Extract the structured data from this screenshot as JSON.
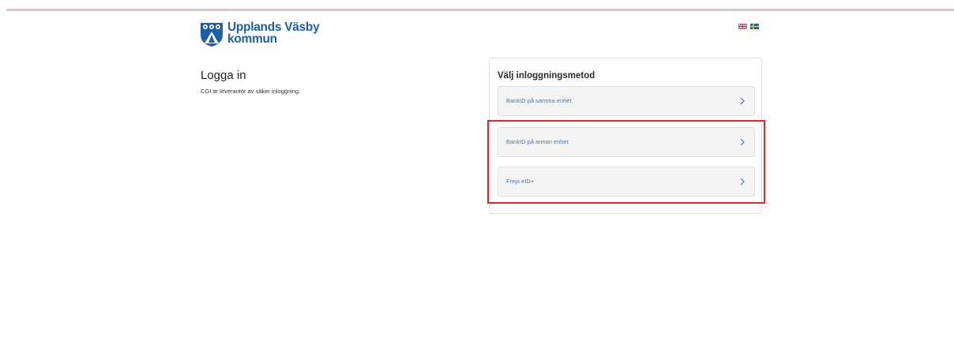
{
  "brand": {
    "name_line1": "Upplands Väsby",
    "name_line2": "kommun",
    "color": "#1d5fa7"
  },
  "languages": [
    {
      "icon": "uk-flag-icon"
    },
    {
      "icon": "sweden-flag-icon"
    }
  ],
  "page": {
    "title": "Logga in",
    "subtitle": "CGI är leverantör av säker inloggning."
  },
  "login_card": {
    "title": "Välj inloggningsmetod",
    "methods": [
      {
        "label": "BankID på samma enhet",
        "icon": "chevron-right-icon"
      },
      {
        "label": "BankID på annan enhet",
        "icon": "chevron-right-icon"
      },
      {
        "label": "Freja eID+",
        "icon": "chevron-right-icon"
      }
    ]
  },
  "colors": {
    "top_bar": "#e6bfd6",
    "highlight": "#e0262e",
    "link": "#4a78b5"
  }
}
